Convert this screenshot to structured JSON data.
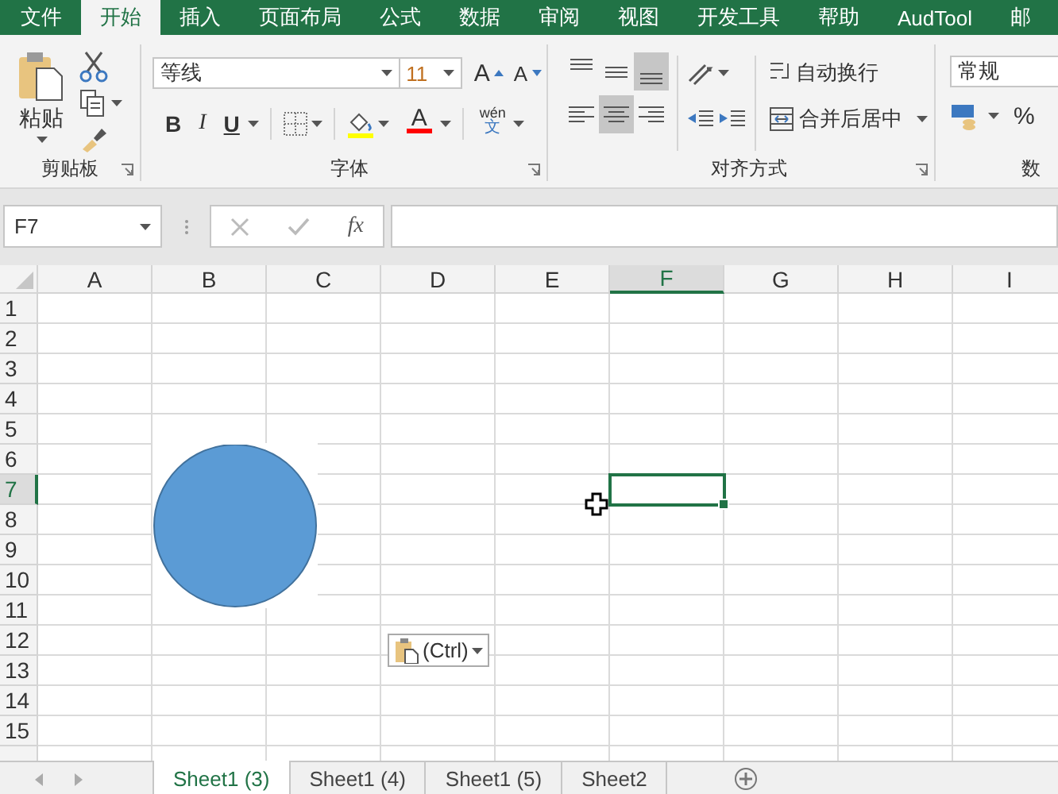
{
  "menu_tabs": [
    {
      "label": "文件",
      "selected": false
    },
    {
      "label": "开始",
      "selected": true
    },
    {
      "label": "插入",
      "selected": false
    },
    {
      "label": "页面布局",
      "selected": false
    },
    {
      "label": "公式",
      "selected": false
    },
    {
      "label": "数据",
      "selected": false
    },
    {
      "label": "审阅",
      "selected": false
    },
    {
      "label": "视图",
      "selected": false
    },
    {
      "label": "开发工具",
      "selected": false
    },
    {
      "label": "帮助",
      "selected": false
    },
    {
      "label": "AudTool",
      "selected": false
    },
    {
      "label": "邮",
      "selected": false
    }
  ],
  "clipboard": {
    "paste_label": "粘贴",
    "group_label": "剪贴板"
  },
  "font": {
    "name": "等线",
    "size": "11",
    "grow": "A",
    "shrink": "A",
    "bold": "B",
    "italic": "I",
    "underline": "U",
    "color_letter": "A",
    "phonetic_top": "wén",
    "phonetic_bottom": "文",
    "group_label": "字体"
  },
  "alignment": {
    "vertical": [
      {
        "kind": "top",
        "selected": false
      },
      {
        "kind": "middle",
        "selected": false
      },
      {
        "kind": "bottom",
        "selected": true
      }
    ],
    "horizontal": [
      {
        "kind": "left",
        "selected": false
      },
      {
        "kind": "center",
        "selected": true
      },
      {
        "kind": "right",
        "selected": false
      }
    ],
    "wrap_text": "自动换行",
    "merge_center": "合并后居中",
    "group_label": "对齐方式"
  },
  "number": {
    "format": "常规",
    "percent": "%",
    "group_label": "数"
  },
  "formula_bar": {
    "name_box": "F7",
    "function_label": "fx"
  },
  "sheet": {
    "columns": [
      {
        "label": "A",
        "selected": false
      },
      {
        "label": "B",
        "selected": false
      },
      {
        "label": "C",
        "selected": false
      },
      {
        "label": "D",
        "selected": false
      },
      {
        "label": "E",
        "selected": false
      },
      {
        "label": "F",
        "selected": true
      },
      {
        "label": "G",
        "selected": false
      },
      {
        "label": "H",
        "selected": false
      },
      {
        "label": "I",
        "selected": false
      }
    ],
    "rows": [
      {
        "label": "1",
        "selected": false
      },
      {
        "label": "2",
        "selected": false
      },
      {
        "label": "3",
        "selected": false
      },
      {
        "label": "4",
        "selected": false
      },
      {
        "label": "5",
        "selected": false
      },
      {
        "label": "6",
        "selected": false
      },
      {
        "label": "7",
        "selected": true
      },
      {
        "label": "8",
        "selected": false
      },
      {
        "label": "9",
        "selected": false
      },
      {
        "label": "10",
        "selected": false
      },
      {
        "label": "11",
        "selected": false
      },
      {
        "label": "12",
        "selected": false
      },
      {
        "label": "13",
        "selected": false
      },
      {
        "label": "14",
        "selected": false
      },
      {
        "label": "15",
        "selected": false
      }
    ]
  },
  "paste_options": {
    "label": "(Ctrl)"
  },
  "sheet_tabs": [
    {
      "label": "Sheet1 (3)",
      "selected": true
    },
    {
      "label": "Sheet1 (4)",
      "selected": false
    },
    {
      "label": "Sheet1 (5)",
      "selected": false
    },
    {
      "label": "Sheet2",
      "selected": false
    }
  ]
}
